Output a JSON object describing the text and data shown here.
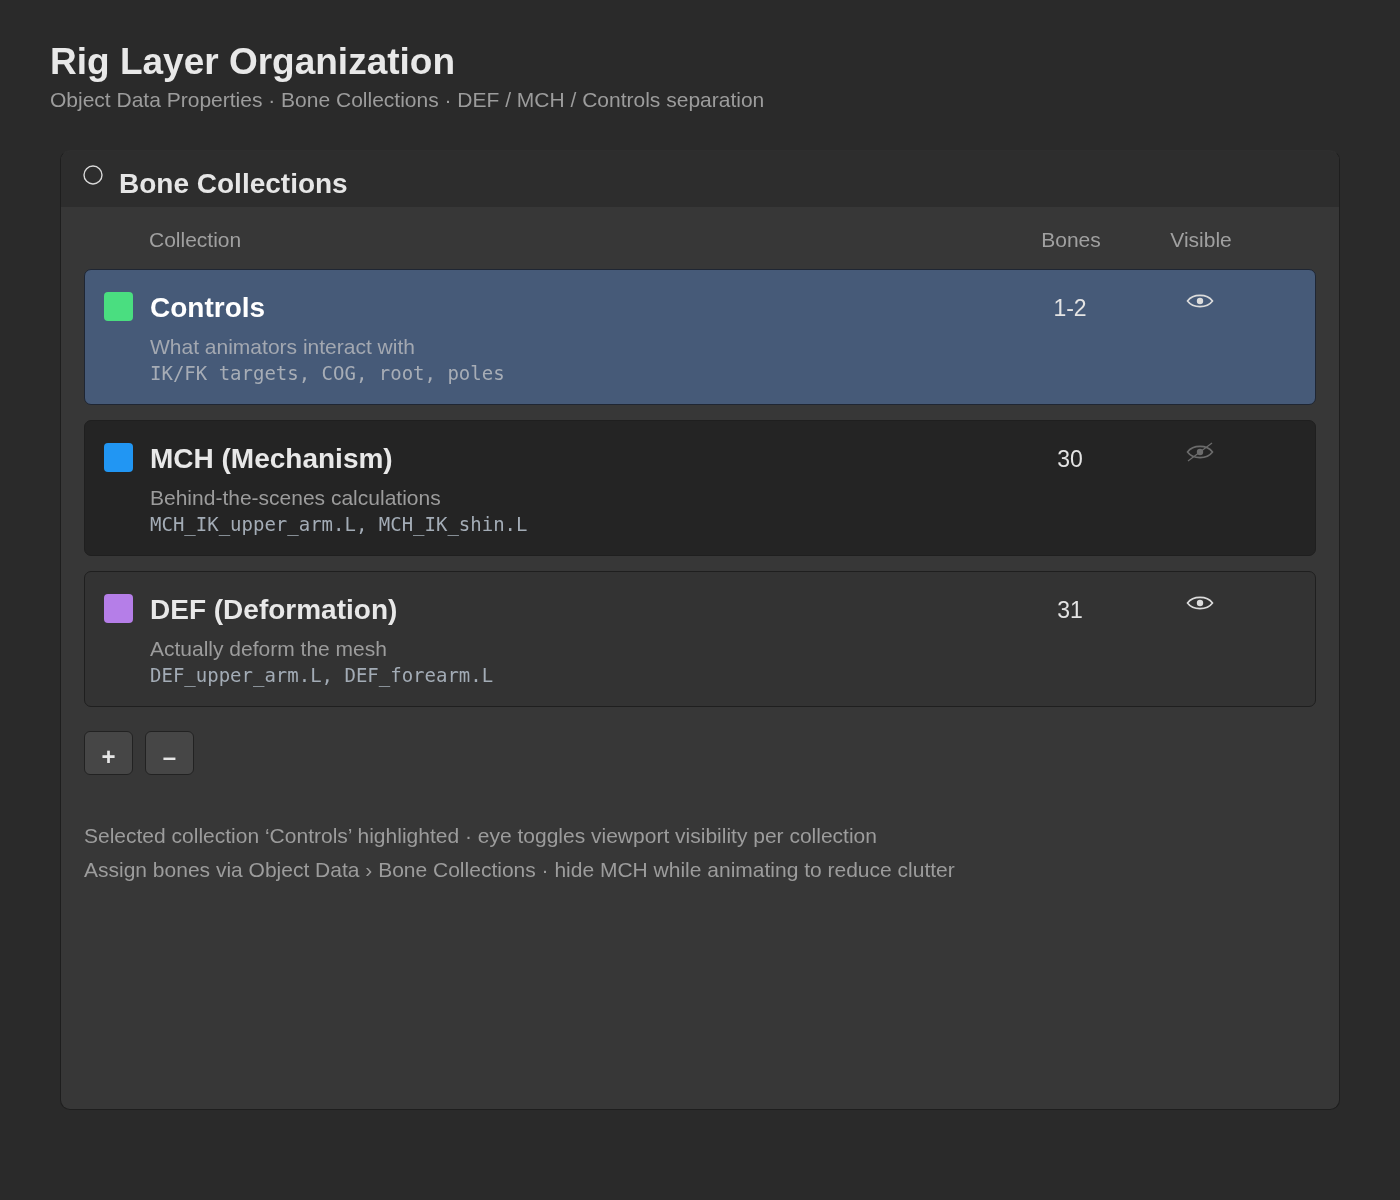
{
  "page": {
    "title": "Rig Layer Organization",
    "subtitle": "Object Data Properties · Bone Collections · DEF / MCH / Controls separation"
  },
  "panel": {
    "title": "Bone Collections"
  },
  "columns": [
    "Collection",
    "Bones",
    "Visible"
  ],
  "collections": [
    {
      "name": "Controls",
      "description": "What animators interact with",
      "bones": "IK/FK targets, COG, root, poles",
      "count": "1-2",
      "color": "#4ade80",
      "selected": true,
      "visible": true
    },
    {
      "name": "MCH (Mechanism)",
      "description": "Behind-the-scenes calculations",
      "bones": "MCH_IK_upper_arm.L, MCH_IK_shin.L",
      "count": "30",
      "color": "#2196f3",
      "selected": false,
      "visible": false
    },
    {
      "name": "DEF (Deformation)",
      "description": "Actually deform the mesh",
      "bones": "DEF_upper_arm.L, DEF_forearm.L",
      "count": "31",
      "color": "#b57ee8",
      "selected": false,
      "visible": true
    }
  ],
  "buttons": [
    "+",
    "–"
  ],
  "notes": [
    "Selected collection ‘Controls’ highlighted · eye toggles viewport visibility per collection",
    "Assign bones via Object Data › Bone Collections · hide MCH while animating to reduce clutter"
  ]
}
